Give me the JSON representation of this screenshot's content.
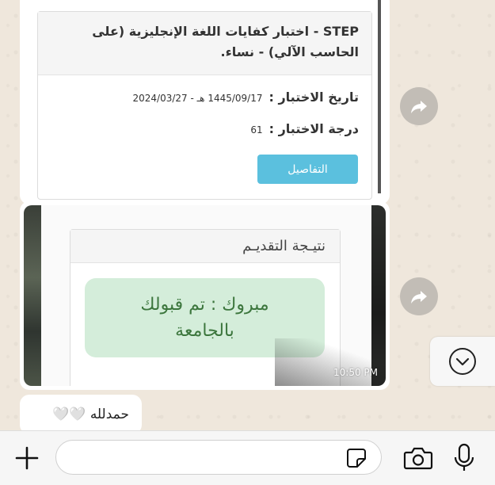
{
  "step_card": {
    "title": "STEP - اختبار كفايات اللغة الإنجليزية (على الحاسب الآلي) - نساء.",
    "date_label": "تاريخ الاختبار :",
    "date_value": "1445/09/17 هـ - 2024/03/27",
    "score_label": "درجة الاختبار :",
    "score_value": "61",
    "details_button": "التفاصيل"
  },
  "result_card": {
    "heading": "نتيـجة التقديـم",
    "message": "مبروك : تم قبولك بالجامعة"
  },
  "image_message": {
    "time": "10:50 PM"
  },
  "text_message": {
    "text": "حمدلله 🤍🤍"
  },
  "composer": {
    "input_value": "",
    "input_placeholder": ""
  },
  "icons": [
    "forward-icon",
    "chevron-down-icon",
    "plus-icon",
    "sticker-icon",
    "camera-icon",
    "microphone-icon"
  ],
  "colors": {
    "info_button": "#5bc0de",
    "success_bg": "#d4edda",
    "success_text": "#3c763d",
    "chat_bg": "#efe7dc"
  }
}
